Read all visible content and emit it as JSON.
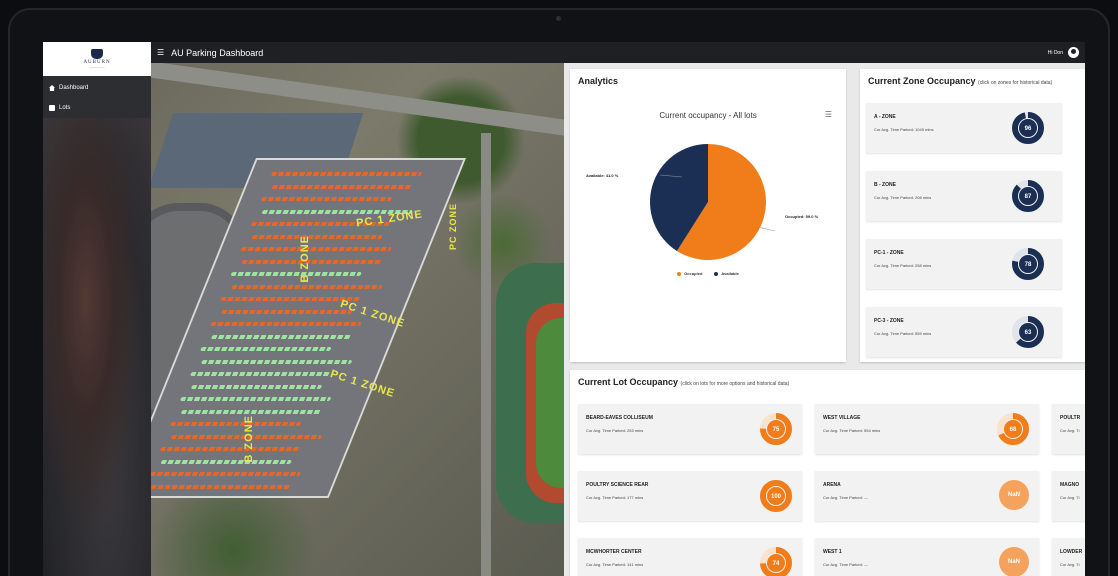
{
  "app": {
    "title": "AU Parking Dashboard",
    "greeting": "Hi Don",
    "logo_text": "AUBURN",
    "colors": {
      "accent": "#f07d1a",
      "navy": "#1b2f55",
      "sidebar": "#2d2e32",
      "topbar": "#1f2024"
    }
  },
  "sidebar": {
    "items": [
      {
        "label": "Dashboard",
        "icon": "home-icon"
      },
      {
        "label": "Lots",
        "icon": "lots-icon"
      }
    ]
  },
  "map": {
    "zone_labels": [
      "B ZONE",
      "PC 1 ZONE",
      "PC 1 ZONE",
      "PC 1 ZONE",
      "B ZONE",
      "PC ZONE"
    ]
  },
  "analytics": {
    "title": "Analytics",
    "chart_title": "Current occupancy - All lots",
    "available_label": "Available: 41.0 %",
    "occupied_label": "Occupied: 59.0 %",
    "legend": [
      "Occupied",
      "Available"
    ]
  },
  "chart_data": {
    "type": "pie",
    "title": "Current occupancy - All lots",
    "categories": [
      "Occupied",
      "Available"
    ],
    "values": [
      59.0,
      41.0
    ],
    "colors": [
      "#f07d1a",
      "#1b2f55"
    ],
    "legend": "bottom"
  },
  "zones": {
    "title": "Current Zone Occupancy",
    "hint": "(click on zones for historical data)",
    "items": [
      {
        "name": "A - ZONE",
        "sub": "Cur Avg. Time Parked: 1049 mins",
        "value": "96"
      },
      {
        "name": "B - ZONE",
        "sub": "Cur Avg. Time Parked: 208 mins",
        "value": "87"
      },
      {
        "name": "PC-1 - ZONE",
        "sub": "Cur Avg. Time Parked: 258 mins",
        "value": "78"
      },
      {
        "name": "PC-3 - ZONE",
        "sub": "Cur Avg. Time Parked: 559 mins",
        "value": "63"
      }
    ]
  },
  "lots": {
    "title": "Current Lot Occupancy",
    "hint": "(click on lots for more options and historical data)",
    "items": [
      {
        "name": "BEARD-EAVES COLLISEUM",
        "sub": "Cur Avg. Time Parked: 253 mins",
        "value": "75"
      },
      {
        "name": "WEST VILLAGE",
        "sub": "Cur Avg. Time Parked: 554 mins",
        "value": "68"
      },
      {
        "name": "POULTR",
        "sub": "Cur Avg. Ti",
        "value": ""
      },
      {
        "name": "POULTRY SCIENCE REAR",
        "sub": "Cur Avg. Time Parked: 177 mins",
        "value": "100"
      },
      {
        "name": "ARENA",
        "sub": "Cur Avg. Time Parked: ---",
        "value": "NaN"
      },
      {
        "name": "MAGNO",
        "sub": "Cur Avg. Ti",
        "value": ""
      },
      {
        "name": "MCWHORTER CENTER",
        "sub": "Cur Avg. Time Parked: 141 mins",
        "value": "74"
      },
      {
        "name": "WEST 1",
        "sub": "Cur Avg. Time Parked: ---",
        "value": "NaN"
      },
      {
        "name": "LOWDER",
        "sub": "Cur Avg. Ti",
        "value": ""
      }
    ]
  }
}
